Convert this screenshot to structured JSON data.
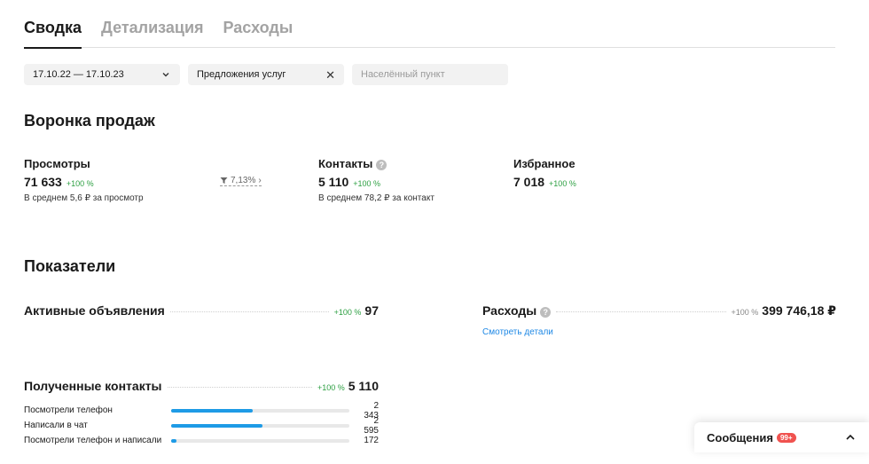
{
  "tabs": [
    {
      "label": "Сводка",
      "active": true
    },
    {
      "label": "Детализация",
      "active": false
    },
    {
      "label": "Расходы",
      "active": false
    }
  ],
  "filters": {
    "date_range": "17.10.22 — 17.10.23",
    "service": "Предложения услуг",
    "city_placeholder": "Населённый пункт"
  },
  "funnel": {
    "title": "Воронка продаж",
    "views": {
      "label": "Просмотры",
      "value": "71 633",
      "delta": "+100 %",
      "sub": "В среднем 5,6 ₽ за просмотр"
    },
    "conversion": "7,13%",
    "contacts": {
      "label": "Контакты",
      "value": "5 110",
      "delta": "+100 %",
      "sub": "В среднем 78,2 ₽ за контакт"
    },
    "favorites": {
      "label": "Избранное",
      "value": "7 018",
      "delta": "+100 %"
    }
  },
  "indicators": {
    "title": "Показатели",
    "active_ads": {
      "label": "Активные объявления",
      "delta": "+100 %",
      "value": "97"
    },
    "expenses": {
      "label": "Расходы",
      "delta": "+100 %",
      "value": "399 746,18 ₽",
      "link": "Смотреть детали"
    },
    "received_contacts": {
      "label": "Полученные контакты",
      "delta": "+100 %",
      "value": "5 110"
    },
    "breakdown": [
      {
        "label": "Посмотрели телефон",
        "value": "2 343",
        "share": 0.46
      },
      {
        "label": "Написали в чат",
        "value": "2 595",
        "share": 0.51
      },
      {
        "label": "Посмотрели телефон и написали",
        "value": "172",
        "share": 0.03
      }
    ]
  },
  "messages": {
    "label": "Сообщения",
    "badge": "99+"
  },
  "colors": {
    "accent": "#1e9be6",
    "positive": "#2ea043",
    "badge": "#f0524f"
  },
  "icons": [
    "chevron-down-icon",
    "close-icon",
    "funnel-icon",
    "chevron-right-icon",
    "question-icon",
    "chevron-up-icon"
  ]
}
